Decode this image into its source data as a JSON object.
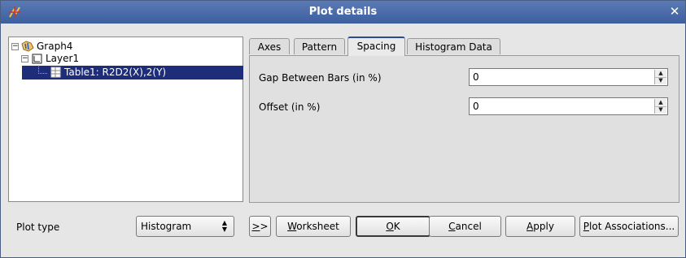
{
  "window": {
    "title": "Plot details",
    "close_glyph": "✕",
    "app_icon": "graph-app-icon"
  },
  "tree": {
    "nodes": [
      {
        "label": "Graph4",
        "icon": "graph-folder-icon",
        "level": 0,
        "expanded": true
      },
      {
        "label": "Layer1",
        "icon": "layer-icon",
        "level": 1,
        "expanded": true
      },
      {
        "label": "Table1: R2D2(X),2(Y)",
        "icon": "table-icon",
        "level": 2,
        "selected": true
      }
    ]
  },
  "tabs": [
    {
      "label": "Axes",
      "active": false
    },
    {
      "label": "Pattern",
      "active": false
    },
    {
      "label": "Spacing",
      "active": true
    },
    {
      "label": "Histogram Data",
      "active": false
    }
  ],
  "spacing": {
    "gap_label": "Gap Between Bars (in %)",
    "gap_value": "0",
    "offset_label": "Offset (in %)",
    "offset_value": "0"
  },
  "footer": {
    "plot_type_label": "Plot type",
    "plot_type_value": "Histogram",
    "more_button": {
      "mn": ">",
      "rest": ">"
    },
    "worksheet_button": {
      "mn": "W",
      "rest": "orksheet"
    },
    "ok_button": {
      "mn": "O",
      "rest": "K"
    },
    "cancel_button": {
      "mn": "C",
      "rest": "ancel"
    },
    "apply_button": {
      "mn": "A",
      "rest": "pply"
    },
    "plot_assoc_button": {
      "mn": "P",
      "rest": "lot Associations..."
    }
  },
  "colors": {
    "titlebar": "#3d5f9e",
    "selection": "#1d2d7a",
    "active_tab_accent": "#2b4a8f"
  }
}
